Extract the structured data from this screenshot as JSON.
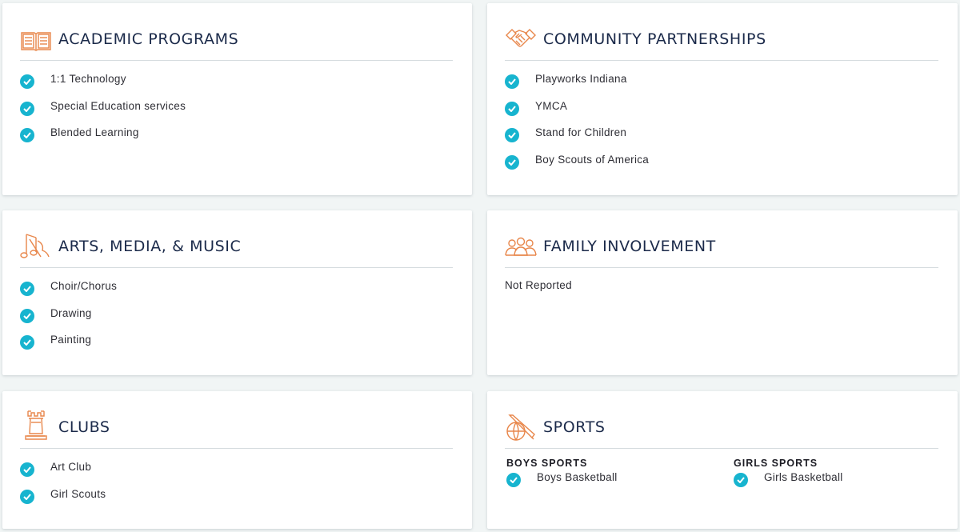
{
  "cards": {
    "academic": {
      "title": "ACADEMIC PROGRAMS",
      "icon": "open-book-icon",
      "items": [
        "1:1 Technology",
        "Special Education services",
        "Blended Learning"
      ]
    },
    "community": {
      "title": "COMMUNITY PARTNERSHIPS",
      "icon": "handshake-icon",
      "items": [
        "Playworks Indiana",
        "YMCA",
        "Stand for Children",
        "Boy Scouts of America"
      ]
    },
    "arts": {
      "title": "ARTS, MEDIA, & MUSIC",
      "icon": "music-note-icon",
      "items": [
        "Choir/Chorus",
        "Drawing",
        "Painting"
      ]
    },
    "family": {
      "title": "FAMILY INVOLVEMENT",
      "icon": "family-icon",
      "text": "Not Reported"
    },
    "clubs": {
      "title": "CLUBS",
      "icon": "chess-rook-icon",
      "items": [
        "Art Club",
        "Girl Scouts"
      ]
    },
    "sports": {
      "title": "SPORTS",
      "icon": "sports-ball-bat-icon",
      "boys_heading": "BOYS SPORTS",
      "boys": [
        "Boys Basketball"
      ],
      "girls_heading": "GIRLS SPORTS",
      "girls": [
        "Girls Basketball"
      ]
    }
  },
  "colors": {
    "accent_icon": "#e8864a",
    "check": "#17b4cf",
    "title": "#1b2a4a"
  }
}
